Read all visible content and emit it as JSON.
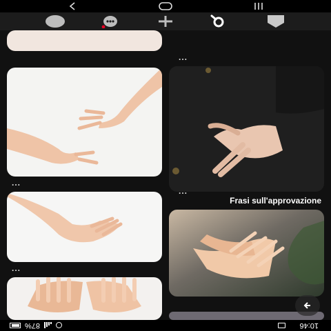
{
  "status_bar": {
    "time": "10:46",
    "battery": "87%"
  },
  "feed": {
    "promo_label": "Frasi sull'approvazione",
    "more_glyph": "...",
    "pins": [
      {
        "subject": "hands reaching toward each other on white background"
      },
      {
        "subject": "hand resting with crossed fingers on dark sweater"
      },
      {
        "subject": "hands in warm sunlight with plants"
      },
      {
        "subject": "hand reaching down over white background"
      },
      {
        "subject": "two hands side by side, palms down"
      }
    ]
  },
  "tab_bar": {
    "items": [
      {
        "icon": "home-icon",
        "active": true
      },
      {
        "icon": "search-icon",
        "active": false
      },
      {
        "icon": "create-plus-icon",
        "active": false
      },
      {
        "icon": "notifications-chat-icon",
        "active": false,
        "badge_color": "#e60023"
      },
      {
        "icon": "profile-avatar-icon",
        "active": false
      }
    ]
  },
  "colors": {
    "background": "#111111",
    "badge": "#e60023"
  }
}
